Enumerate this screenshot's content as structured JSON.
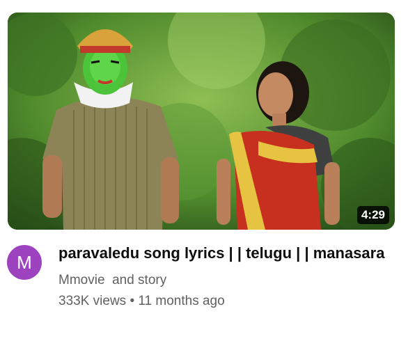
{
  "video": {
    "duration": "4:29",
    "title": "paravaledu song lyrics | | telugu | | manasara",
    "channel_name": "Mmovie  and story",
    "views": "333K views",
    "separator": "•",
    "age": "11 months ago"
  },
  "avatar": {
    "letter": "M",
    "color": "#9d43c0"
  }
}
